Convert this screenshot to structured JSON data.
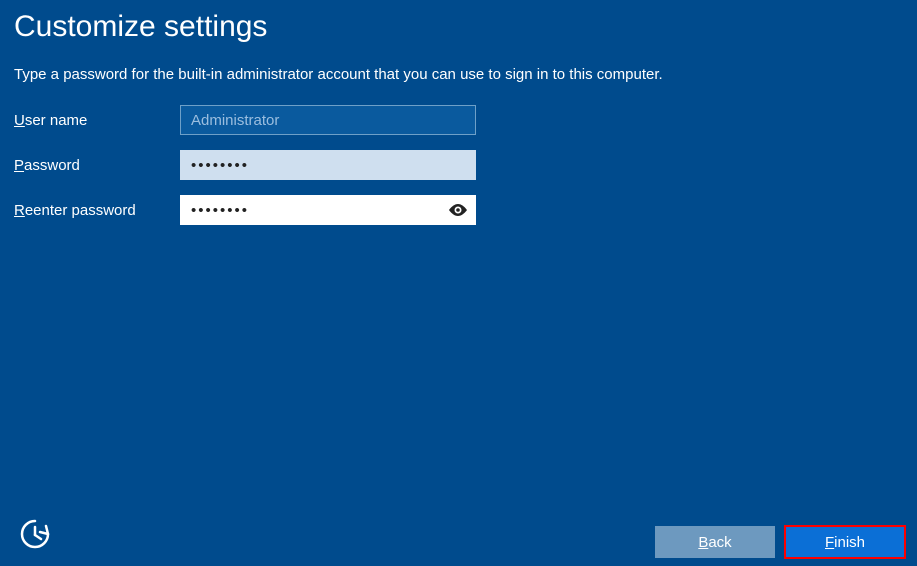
{
  "page": {
    "title": "Customize settings",
    "subtitle": "Type a password for the built-in administrator account that you can use to sign in to this computer."
  },
  "labels": {
    "username_prefix": "U",
    "username_rest": "ser name",
    "password_prefix": "P",
    "password_rest": "assword",
    "reenter_prefix": "R",
    "reenter_rest": "eenter password"
  },
  "fields": {
    "username_value": "Administrator",
    "password_value": "••••••••",
    "reenter_value": "••••••••"
  },
  "buttons": {
    "back_prefix": "B",
    "back_rest": "ack",
    "finish_prefix": "F",
    "finish_rest": "inish"
  }
}
